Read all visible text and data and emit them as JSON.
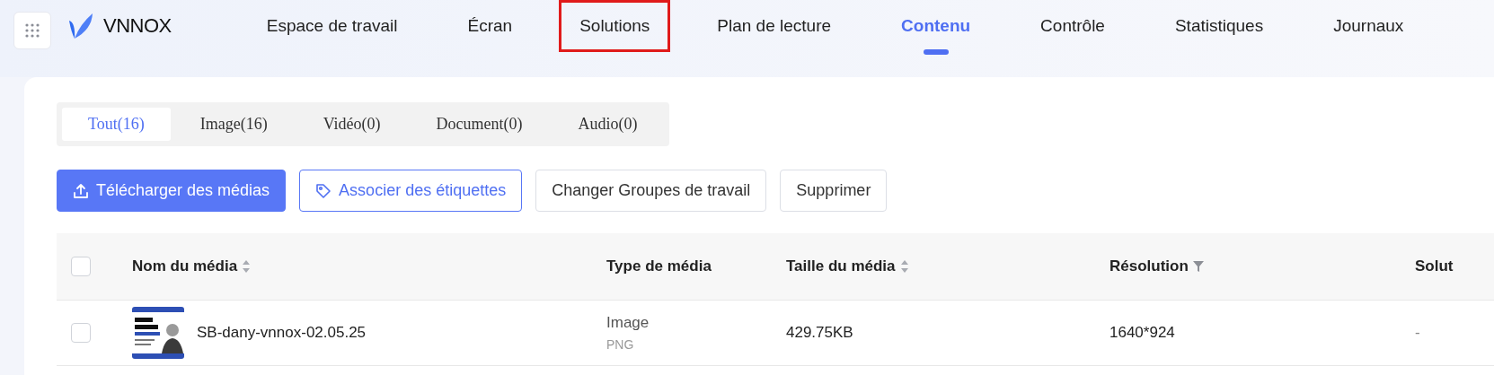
{
  "nav": {
    "items": [
      {
        "label": "Espace de travail",
        "selected": false,
        "highlighted": false
      },
      {
        "label": "Écran",
        "selected": false,
        "highlighted": false
      },
      {
        "label": "Solutions",
        "selected": false,
        "highlighted": true
      },
      {
        "label": "Plan de lecture",
        "selected": false,
        "highlighted": false
      },
      {
        "label": "Contenu",
        "selected": true,
        "highlighted": false
      },
      {
        "label": "Contrôle",
        "selected": false,
        "highlighted": false
      },
      {
        "label": "Statistiques",
        "selected": false,
        "highlighted": false
      },
      {
        "label": "Journaux",
        "selected": false,
        "highlighted": false
      }
    ]
  },
  "logo": {
    "text": "VNNOX"
  },
  "tabs": [
    {
      "label": "Tout(16)",
      "selected": true
    },
    {
      "label": "Image(16)",
      "selected": false
    },
    {
      "label": "Vidéo(0)",
      "selected": false
    },
    {
      "label": "Document(0)",
      "selected": false
    },
    {
      "label": "Audio(0)",
      "selected": false
    }
  ],
  "buttons": [
    {
      "label": "Télécharger des médias",
      "kind": "primary"
    },
    {
      "label": "Associer des étiquettes",
      "kind": "outline"
    },
    {
      "label": "Changer Groupes de travail",
      "kind": "default"
    },
    {
      "label": "Supprimer",
      "kind": "default"
    }
  ],
  "table": {
    "select_all": {
      "checked": false
    },
    "columns": [
      {
        "label": "Nom du média",
        "sort": true,
        "filter": false
      },
      {
        "label": "Type de média",
        "sort": false,
        "filter": false
      },
      {
        "label": "Taille du média",
        "sort": true,
        "filter": false
      },
      {
        "label": "Résolution",
        "sort": false,
        "filter": true
      },
      {
        "label": "Solut",
        "sort": false,
        "filter": false
      }
    ],
    "rows": [
      {
        "checked": false,
        "name": "SB-dany-vnnox-02.05.25",
        "type": "Image",
        "format": "PNG",
        "size": "429.75KB",
        "resolution": "1640*924",
        "column_5": "-"
      }
    ]
  }
}
